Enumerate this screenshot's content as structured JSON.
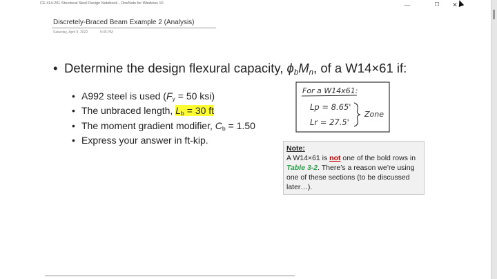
{
  "window": {
    "title": "CE 414-201 Structural Steel Design Notebook - OneNote for Windows 10",
    "minimize": "—",
    "maximize": "☐",
    "close": "✕"
  },
  "page": {
    "title": "Discretely-Braced Beam Example 2 (Analysis)",
    "date": "Saturday, April 9, 2022",
    "time": "5:35 PM"
  },
  "content": {
    "bullet": "•",
    "sub_bullet": "•",
    "main_text_1": "Determine the design flexural capacity, ",
    "phi": "ϕ",
    "phi_sub": "b",
    "M": "M",
    "M_sub": "n",
    "main_text_2": ", of a W14×61 if:",
    "item1_a": "A992 steel is used (",
    "item1_F": "F",
    "item1_F_sub": "y",
    "item1_b": " = 50 ksi)",
    "item2_a": "The unbraced length, ",
    "item2_L": "L",
    "item2_L_sub": "b",
    "item2_b": " = 30 ft",
    "item3_a": "The moment gradient modifier, ",
    "item3_C": "C",
    "item3_C_sub": "b",
    "item3_b": " = 1.50",
    "item4": "Express your answer in ft-kip."
  },
  "handwriting": {
    "heading": "For a W14x61:",
    "lp": "Lp = 8.65'",
    "lr": "Lr = 27.5'",
    "zone": "Zone"
  },
  "note": {
    "title": "Note:",
    "t1": "A W14×61 is ",
    "not": "not",
    "t2": " one of the bold rows in ",
    "table": "Table 3-2",
    "t3": ".  There’s a reason we’re using one of these sections (to be discussed later…)."
  }
}
